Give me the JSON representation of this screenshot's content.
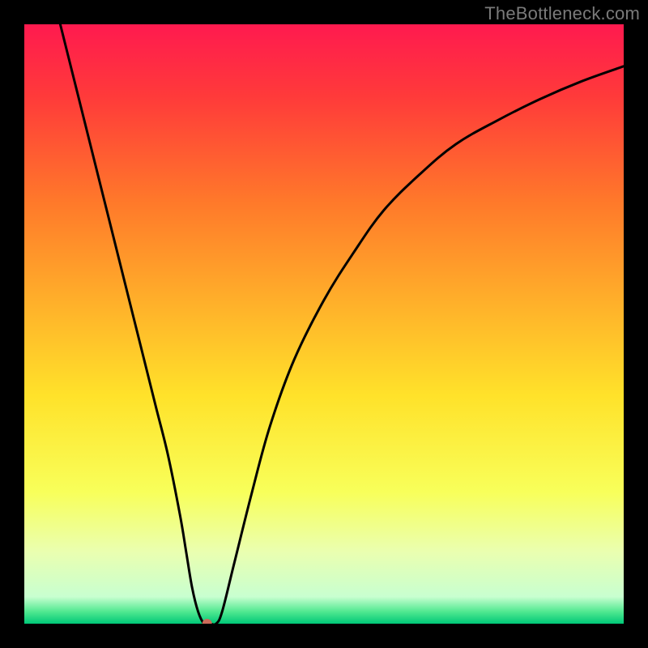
{
  "watermark": "TheBottleneck.com",
  "chart_data": {
    "type": "line",
    "title": "",
    "xlabel": "",
    "ylabel": "",
    "xlim": [
      0,
      100
    ],
    "ylim": [
      0,
      100
    ],
    "background": {
      "type": "vertical-gradient",
      "stops": [
        {
          "offset": 0.0,
          "color": "#ff1a4f"
        },
        {
          "offset": 0.12,
          "color": "#ff3a3a"
        },
        {
          "offset": 0.3,
          "color": "#ff7a2a"
        },
        {
          "offset": 0.48,
          "color": "#ffb52a"
        },
        {
          "offset": 0.62,
          "color": "#ffe22a"
        },
        {
          "offset": 0.78,
          "color": "#f8ff5a"
        },
        {
          "offset": 0.88,
          "color": "#eaffb0"
        },
        {
          "offset": 0.955,
          "color": "#c8ffd0"
        },
        {
          "offset": 0.98,
          "color": "#50e890"
        },
        {
          "offset": 1.0,
          "color": "#00c878"
        }
      ]
    },
    "series": [
      {
        "name": "bottleneck-curve",
        "color": "#000000",
        "x": [
          6,
          8,
          10,
          12,
          14,
          16,
          18,
          20,
          22,
          24,
          26,
          27,
          28,
          29,
          30,
          31,
          32,
          33,
          35,
          38,
          41,
          45,
          50,
          55,
          60,
          66,
          72,
          79,
          86,
          93,
          100
        ],
        "y": [
          100,
          92,
          84,
          76,
          68,
          60,
          52,
          44,
          36,
          28,
          18,
          12,
          6,
          2,
          0,
          0,
          0,
          2,
          10,
          22,
          33,
          44,
          54,
          62,
          69,
          75,
          80,
          84,
          87.5,
          90.5,
          93
        ]
      }
    ],
    "marker": {
      "name": "optimal-point",
      "x": 30.5,
      "y": 0,
      "color": "#cc6b5a",
      "radius": 6
    }
  }
}
